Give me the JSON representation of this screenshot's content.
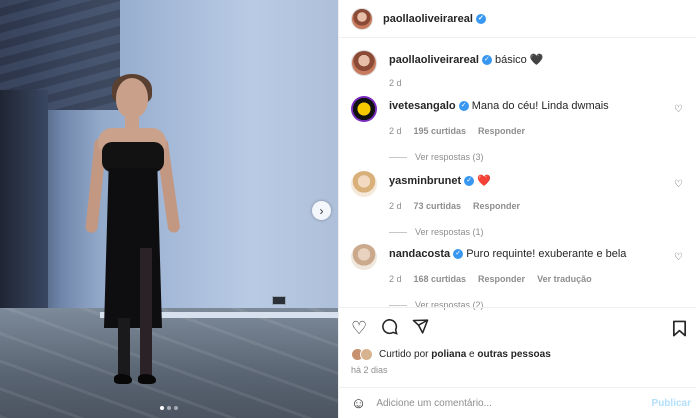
{
  "post": {
    "username": "paollaoliveirareal",
    "caption": {
      "username": "paollaoliveirareal",
      "text": "básico",
      "heart": "🖤",
      "age": "2 d"
    },
    "carousel": {
      "slides": 3,
      "active_index": 1
    }
  },
  "comments": [
    {
      "username": "ivetesangalo",
      "text": "Mana do céu! Linda dwmais",
      "age": "2 d",
      "likes": "195 curtidas",
      "reply": "Responder",
      "translate": "",
      "view_replies": "Ver respostas (3)"
    },
    {
      "username": "yasminbrunet",
      "text": "❤️",
      "age": "2 d",
      "likes": "73 curtidas",
      "reply": "Responder",
      "translate": "",
      "view_replies": "Ver respostas (1)"
    },
    {
      "username": "nandacosta",
      "text": "Puro requinte! exuberante e bela",
      "age": "2 d",
      "likes": "168 curtidas",
      "reply": "Responder",
      "translate": "Ver tradução",
      "view_replies": "Ver respostas (2)"
    }
  ],
  "actions": {
    "like_icon": "heart-icon",
    "comment_icon": "comment-icon",
    "share_icon": "share-icon",
    "save_icon": "bookmark-icon"
  },
  "liked_by": {
    "prefix": "Curtido por",
    "user": "poliana",
    "connector": "e",
    "others": "outras pessoas"
  },
  "posted": "há 2 dias",
  "add_comment": {
    "placeholder": "Adicione um comentário...",
    "publish": "Publicar"
  },
  "colors": {
    "verified": "#3897f0",
    "link": "#b2dffc",
    "muted": "#8e8e8e"
  }
}
